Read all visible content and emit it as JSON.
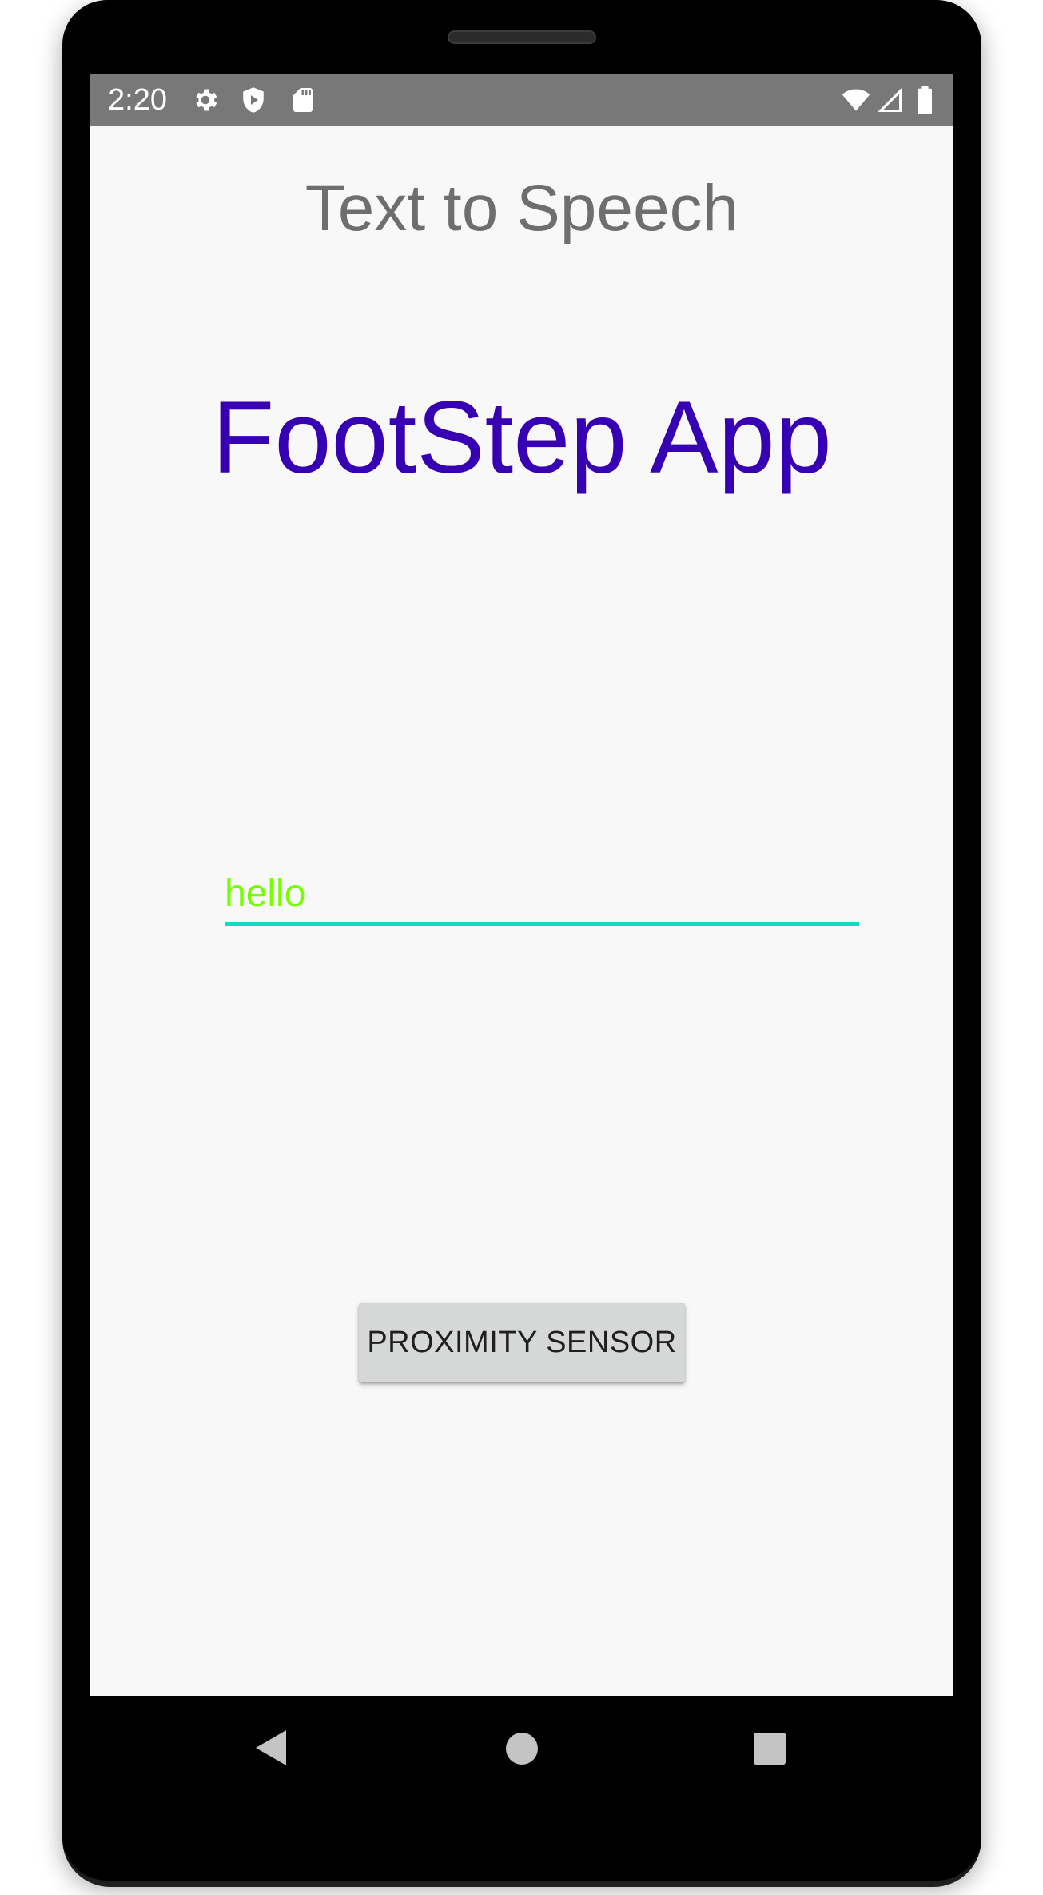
{
  "status_bar": {
    "time": "2:20",
    "left_icons": [
      "settings-icon",
      "play-protect-icon",
      "sd-card-icon"
    ],
    "right_icons": [
      "wifi-icon",
      "cell-signal-icon",
      "battery-icon"
    ],
    "background_color": "#787878"
  },
  "app": {
    "title": "Text to Speech",
    "heading": "FootStep App",
    "heading_color": "#3700b3"
  },
  "input": {
    "value": "hello",
    "text_color": "#76ff03",
    "underline_color": "#10d9c4"
  },
  "button": {
    "label": "PROXIMITY SENSOR"
  },
  "nav_bar": {
    "icons": [
      "back-icon",
      "home-icon",
      "recents-icon"
    ]
  }
}
